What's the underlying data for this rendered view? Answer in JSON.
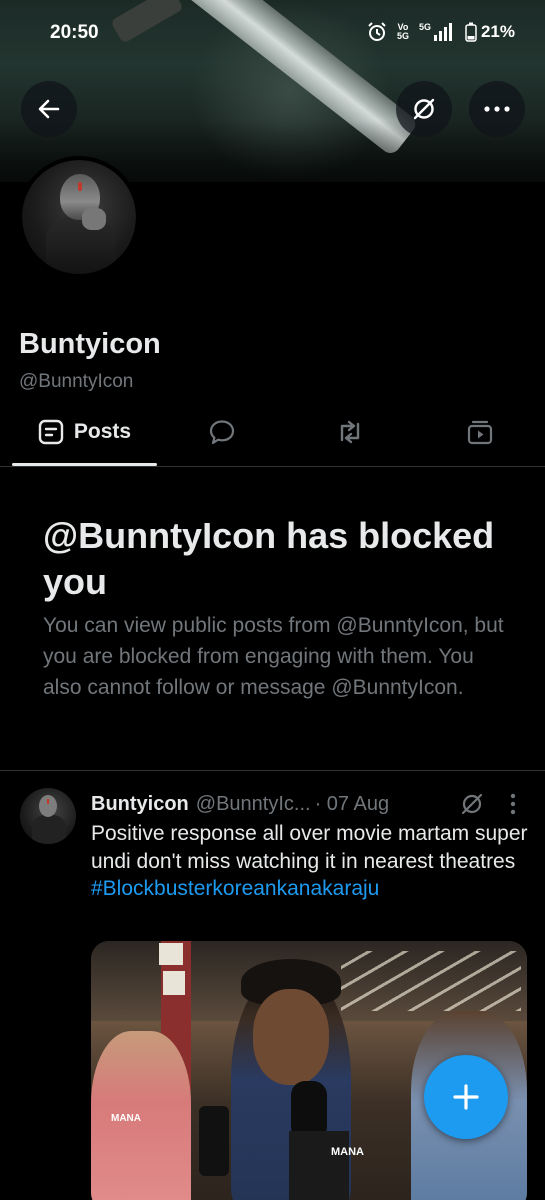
{
  "status_bar": {
    "time": "20:50",
    "volte_top": "Vo",
    "volte_bottom": "5G",
    "network": "5G",
    "battery": "21%"
  },
  "banner": {
    "back_icon": "arrow-left-icon",
    "mute_icon": "mute-notifications-icon",
    "more_icon": "more-horizontal-icon"
  },
  "profile": {
    "display_name": "Buntyicon",
    "handle": "@BunntyIcon"
  },
  "tabs": [
    {
      "label": "Posts",
      "icon": "posts-icon",
      "selected": true
    },
    {
      "label": "",
      "icon": "replies-icon",
      "selected": false
    },
    {
      "label": "",
      "icon": "reposts-icon",
      "selected": false
    },
    {
      "label": "",
      "icon": "media-icon",
      "selected": false
    }
  ],
  "blocked": {
    "title": "@BunntyIcon has blocked you",
    "body": "You can view public posts from @BunntyIcon, but you are blocked from engaging with them. You also cannot follow or message @BunntyIcon."
  },
  "post": {
    "name": "Buntyicon",
    "handle": "@BunntyIc...",
    "date": "· 07 Aug",
    "text": "Positive response all over movie martam super undi don't miss watching it in nearest theatres",
    "hashtag": "#Blockbusterkoreankanakaraju",
    "media_mic_label_1": "MANA",
    "media_mic_label_2": "MANA"
  },
  "fab": {
    "icon": "plus-icon"
  },
  "colors": {
    "background": "#000000",
    "text_primary": "#e7e9ea",
    "text_secondary": "#71767b",
    "accent": "#1d9bf0",
    "divider": "#2f3336"
  }
}
